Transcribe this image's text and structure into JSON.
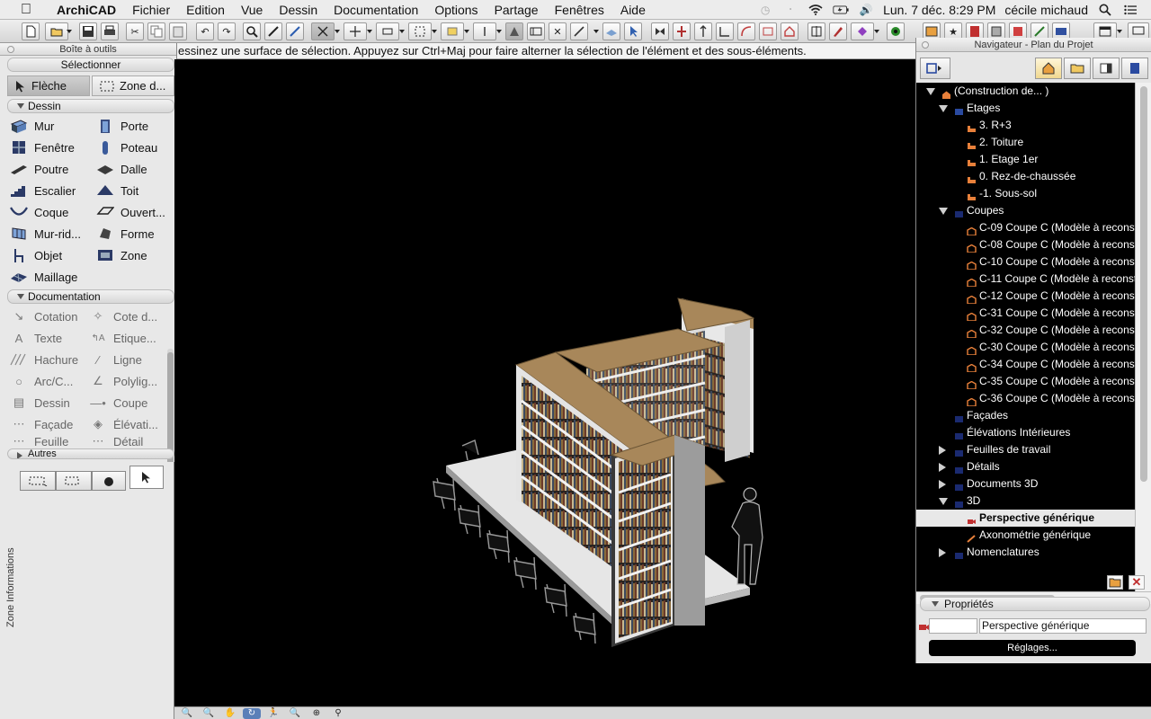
{
  "menubar": {
    "app": "ArchiCAD",
    "items": [
      "Fichier",
      "Edition",
      "Vue",
      "Dessin",
      "Documentation",
      "Options",
      "Partage",
      "Fenêtres",
      "Aide"
    ],
    "clock": "Lun. 7 déc.  8:29 PM",
    "user": "cécile michaud",
    "icons": [
      "time-machine-icon",
      "bluetooth-icon",
      "wifi-icon",
      "battery-icon",
      "volume-icon",
      "search-icon",
      "list-icon"
    ]
  },
  "infoline": "essinez une surface de sélection. Appuyez sur Ctrl+Maj pour faire alterner la sélection de l'élément et des sous-éléments.",
  "toolbox": {
    "title": "Boîte à outils",
    "select_section": "Sélectionner",
    "arrow": "Flèche",
    "marquee": "Zone d...",
    "design_section": "Dessin",
    "design_tools": [
      [
        "Mur",
        "Porte"
      ],
      [
        "Fenêtre",
        "Poteau"
      ],
      [
        "Poutre",
        "Dalle"
      ],
      [
        "Escalier",
        "Toit"
      ],
      [
        "Coque",
        "Ouvert..."
      ],
      [
        "Mur-rid...",
        "Forme"
      ],
      [
        "Objet",
        "Zone"
      ],
      [
        "Maillage",
        ""
      ]
    ],
    "doc_section": "Documentation",
    "doc_tools": [
      [
        "Cotation",
        "Cote d..."
      ],
      [
        "Texte",
        "Etique..."
      ],
      [
        "Hachure",
        "Ligne"
      ],
      [
        "Arc/C...",
        "Polylig..."
      ],
      [
        "Dessin",
        "Coupe"
      ],
      [
        "Façade",
        "Élévati..."
      ],
      [
        "Feuille",
        "Détail"
      ]
    ],
    "other_section": "Autres"
  },
  "infobox": {
    "label": "Zone Informations"
  },
  "navigator": {
    "title": "Navigateur - Plan du Projet",
    "tree": [
      {
        "level": 0,
        "disc": "open",
        "label": "(Construction de... )",
        "icon": "house"
      },
      {
        "level": 1,
        "disc": "open",
        "label": "Etages",
        "icon": "stack"
      },
      {
        "level": 2,
        "disc": "",
        "label": "3. R+3",
        "icon": "story"
      },
      {
        "level": 2,
        "disc": "",
        "label": "2. Toiture",
        "icon": "story"
      },
      {
        "level": 2,
        "disc": "",
        "label": "1. Etage 1er",
        "icon": "story"
      },
      {
        "level": 2,
        "disc": "",
        "label": "0. Rez-de-chaussée",
        "icon": "story"
      },
      {
        "level": 2,
        "disc": "",
        "label": "-1. Sous-sol",
        "icon": "story"
      },
      {
        "level": 1,
        "disc": "open",
        "label": "Coupes",
        "icon": "folder"
      },
      {
        "level": 2,
        "disc": "",
        "label": "C-09 Coupe C (Modèle à reconstr",
        "icon": "section"
      },
      {
        "level": 2,
        "disc": "",
        "label": "C-08 Coupe C (Modèle à reconstr",
        "icon": "section"
      },
      {
        "level": 2,
        "disc": "",
        "label": "C-10 Coupe C (Modèle à reconstr",
        "icon": "section"
      },
      {
        "level": 2,
        "disc": "",
        "label": "C-11 Coupe C (Modèle à reconstr",
        "icon": "section"
      },
      {
        "level": 2,
        "disc": "",
        "label": "C-12 Coupe C (Modèle à reconstr",
        "icon": "section"
      },
      {
        "level": 2,
        "disc": "",
        "label": "C-31 Coupe C (Modèle à reconstr",
        "icon": "section"
      },
      {
        "level": 2,
        "disc": "",
        "label": "C-32 Coupe C (Modèle à reconstr",
        "icon": "section"
      },
      {
        "level": 2,
        "disc": "",
        "label": "C-30 Coupe C (Modèle à reconstr",
        "icon": "section"
      },
      {
        "level": 2,
        "disc": "",
        "label": "C-34 Coupe C (Modèle à reconstr",
        "icon": "section"
      },
      {
        "level": 2,
        "disc": "",
        "label": "C-35 Coupe C (Modèle à reconstr",
        "icon": "section"
      },
      {
        "level": 2,
        "disc": "",
        "label": "C-36 Coupe C (Modèle à reconstr",
        "icon": "section"
      },
      {
        "level": 1,
        "disc": "",
        "label": "Façades",
        "icon": "folder"
      },
      {
        "level": 1,
        "disc": "",
        "label": "Élévations Intérieures",
        "icon": "folder"
      },
      {
        "level": 1,
        "disc": "closed",
        "label": "Feuilles de travail",
        "icon": "folder"
      },
      {
        "level": 1,
        "disc": "closed",
        "label": "Détails",
        "icon": "folder"
      },
      {
        "level": 1,
        "disc": "closed",
        "label": "Documents 3D",
        "icon": "folder"
      },
      {
        "level": 1,
        "disc": "open",
        "label": "3D",
        "icon": "folder"
      },
      {
        "level": 2,
        "disc": "",
        "label": "Perspective générique",
        "icon": "camera",
        "selected": true
      },
      {
        "level": 2,
        "disc": "",
        "label": "Axonométrie générique",
        "icon": "axo"
      },
      {
        "level": 1,
        "disc": "closed",
        "label": "Nomenclatures",
        "icon": "folder"
      }
    ],
    "properties_label": "Propriétés",
    "prop_id": "",
    "prop_name": "Perspective générique",
    "settings_button": "Réglages..."
  },
  "colors": {
    "bg_3d": "#000000",
    "wood_top": "#a8875a",
    "shelf_white": "#e8e8e8",
    "story_orange": "#e8803a"
  }
}
